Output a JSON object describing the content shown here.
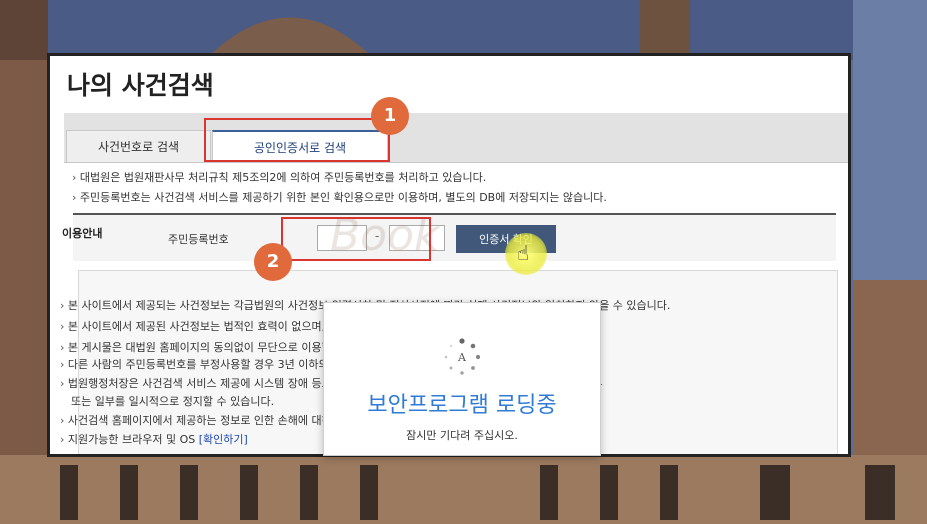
{
  "page": {
    "title": "나의 사건검색"
  },
  "tabs": [
    {
      "label": "사건번호로 검색"
    },
    {
      "label": "공인인증서로 검색"
    }
  ],
  "notices": [
    "대법원은 법원재판사무 처리규칙 제5조의2에 의하여 주민등록번호를 처리하고 있습니다.",
    "주민등록번호는 사건검색 서비스를 제공하기 위한 본인 확인용으로만 이용하며, 별도의 DB에 저장되지는 않습니다."
  ],
  "form": {
    "label": "주민등록번호",
    "dash": "-",
    "verify_button": "인증서 확인"
  },
  "guide": {
    "title": "이용안내",
    "items": [
      "본 사이트에서 제공되는 사건정보는 각급법원의 사건정보 입력시차 및 전산사정에 따라 실제 사건정보와 일치하지 않을 수 있습니다.",
      "본 사이트에서 제공된 사건정보는 법적인 효력이 없으며, 보다 자세한 내용은 해당 법원에 문의하시기 바랍니다.",
      "본 게시물은 대법원 홈페이지의 동의없이 무단으로 이용할 수 없습니다.",
      "다른 사람의 주민등록번호를 부정사용할 경우 3년 이하의 징역 또는 3천만원 이하의 벌금이 부과될 수 있습니다.",
      "법원행정처장은 사건검색 서비스 제공에 시스템 장애 등으로 인한 불가피한 사유가 있을 경우 사건검색 서비스의 전부",
      "사건검색 홈페이지에서 제공하는 정보로 인한 손해에 대하여 책임을 지지 않습니다.",
      "지원가능한 브라우저 및 OS"
    ],
    "item_continuation": "또는 일부를 일시적으로 정지할 수 있습니다.",
    "link": "[확인하기]"
  },
  "loading": {
    "title": "보안프로그램 로딩중",
    "subtitle": "잠시만 기다려 주십시오."
  },
  "callouts": [
    "1",
    "2"
  ],
  "watermark": "Book",
  "colors": {
    "accent": "#e06a3c",
    "highlight": "#d9352e",
    "button": "#41587a",
    "loading_title": "#2f7bd6",
    "link": "#1f48b0"
  }
}
